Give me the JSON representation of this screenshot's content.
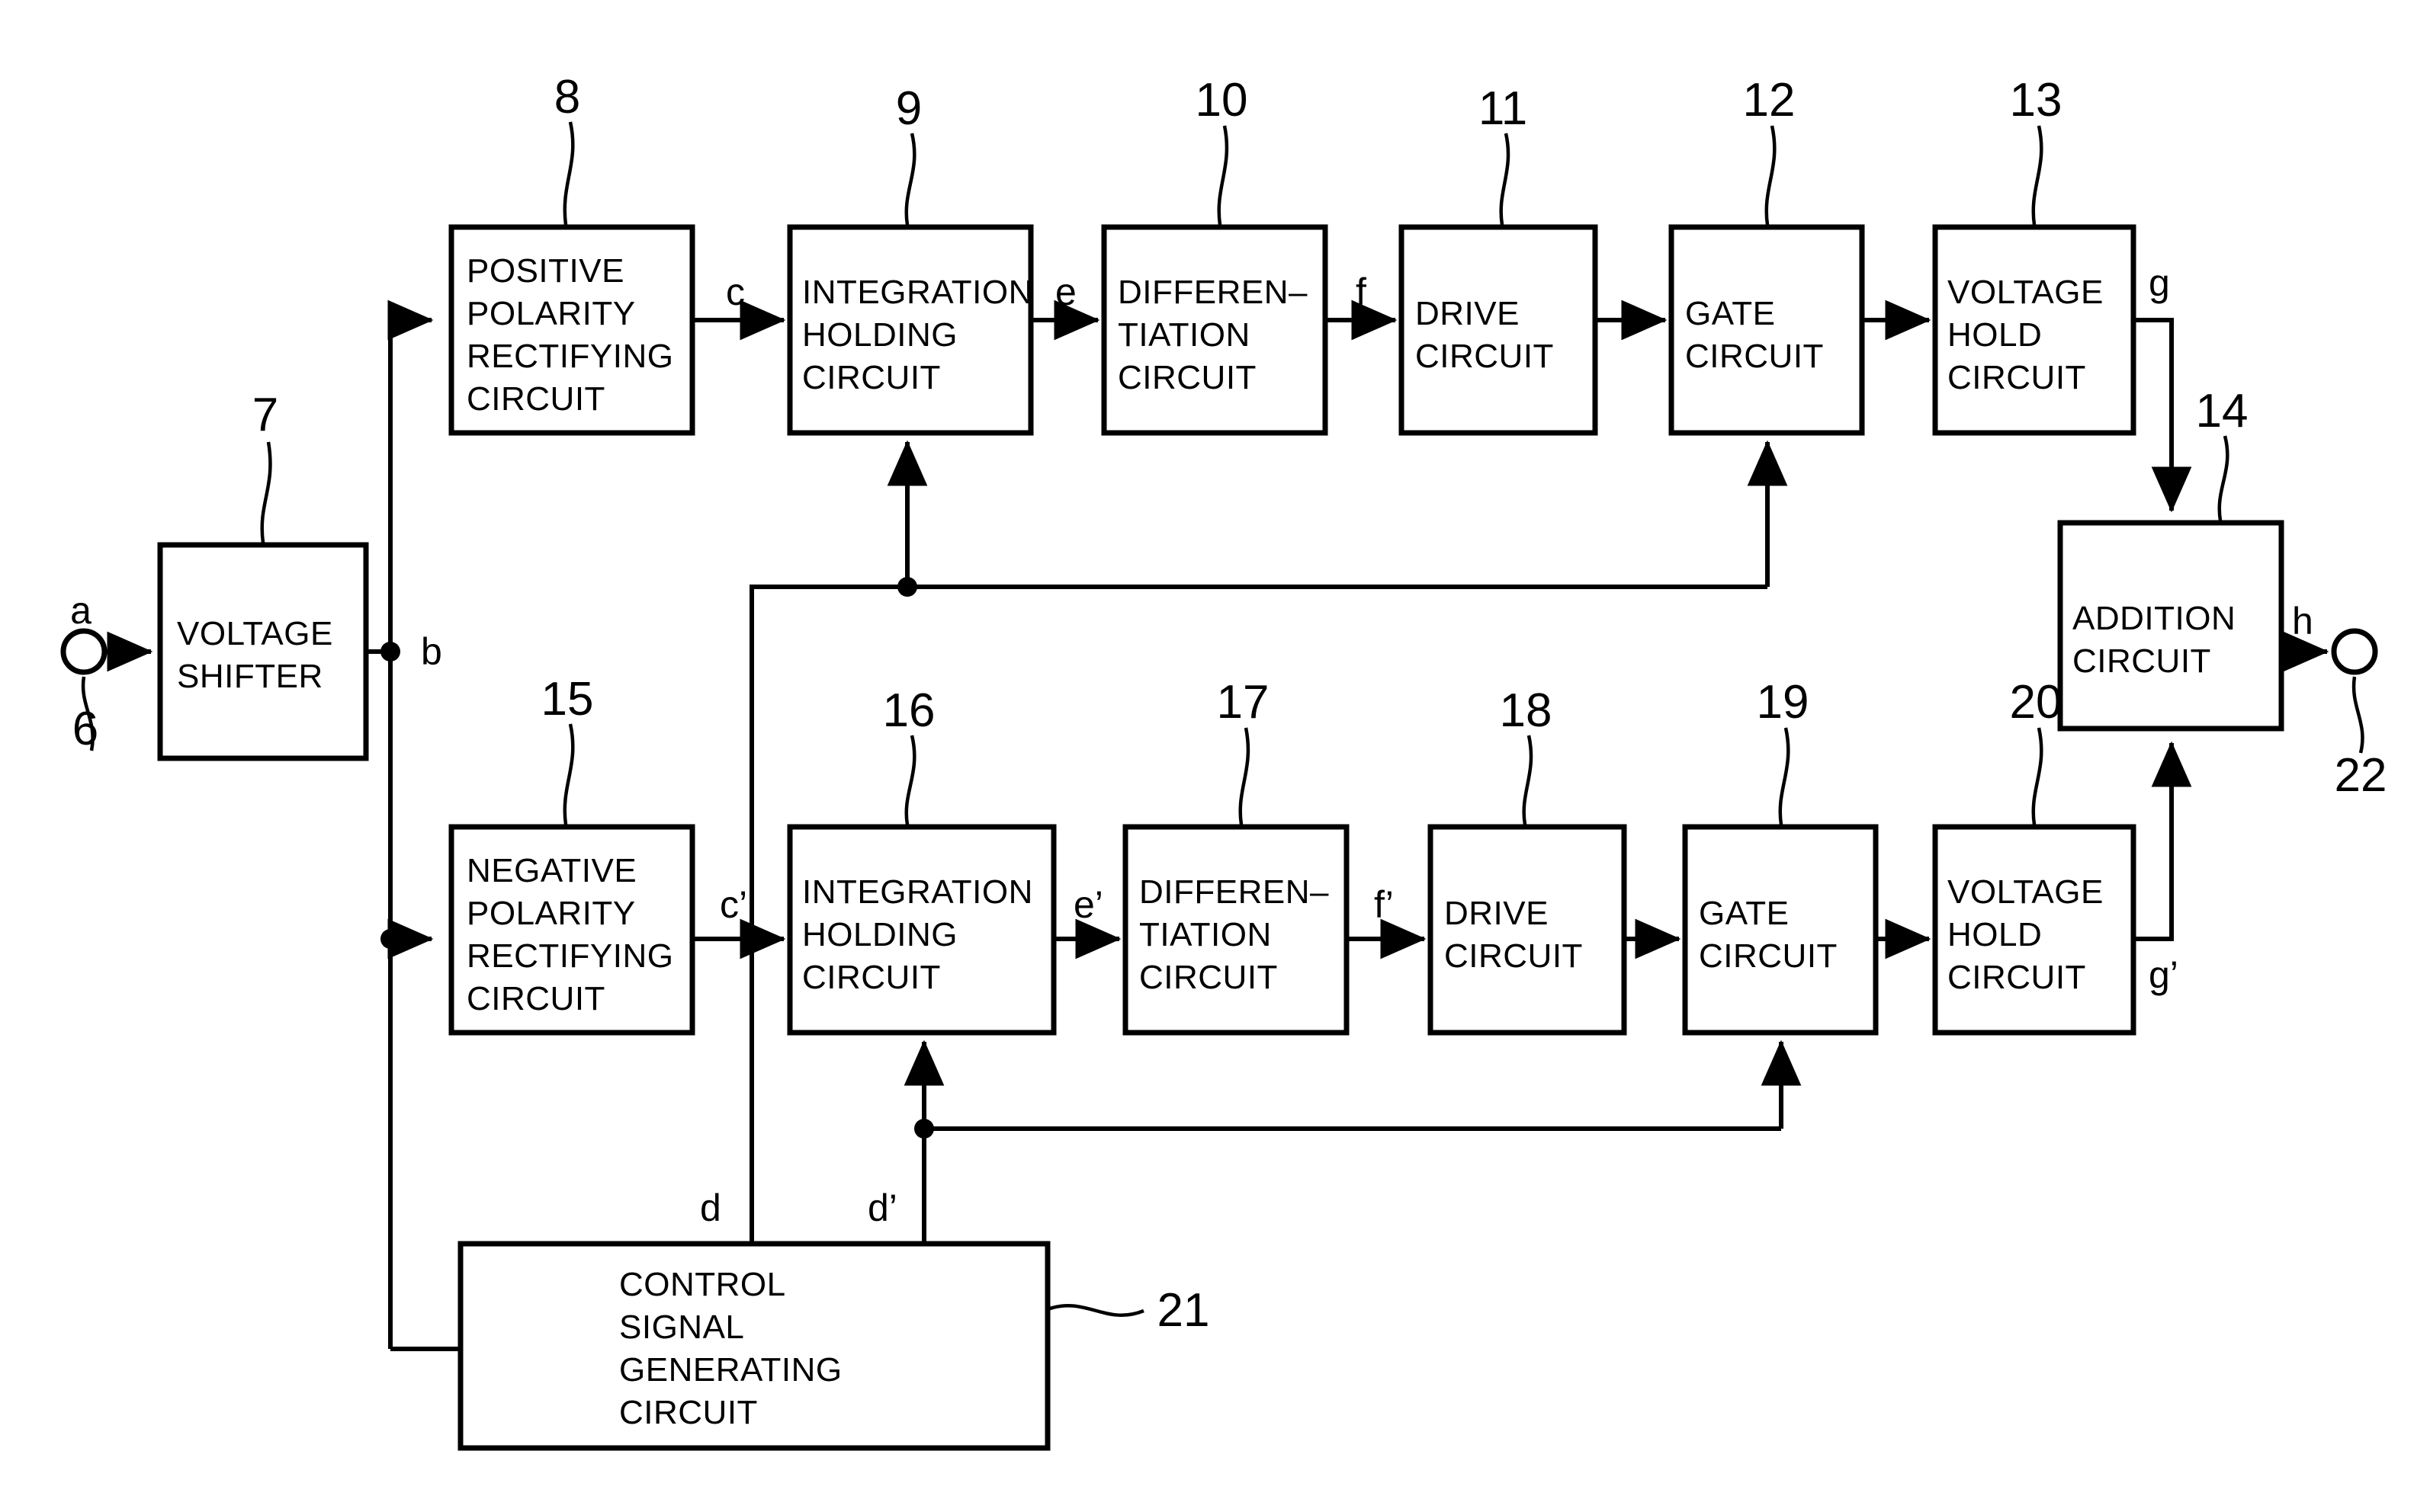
{
  "figure": {
    "kind": "patent-block-diagram",
    "background_color": "#ffffff",
    "line_color": "#000000"
  },
  "blocks": [
    {
      "id": "voltage-shifter",
      "ref": "7",
      "lines": [
        "VOLTAGE",
        "SHIFTER"
      ]
    },
    {
      "id": "positive-polarity-rectifier",
      "ref": "8",
      "lines": [
        "POSITIVE",
        "POLARITY",
        "RECTIFYING",
        "CIRCUIT"
      ]
    },
    {
      "id": "integration-holding-top",
      "ref": "9",
      "lines": [
        "INTEGRATION",
        "HOLDING",
        "CIRCUIT"
      ]
    },
    {
      "id": "differentiation-top",
      "ref": "10",
      "lines": [
        "DIFFEREN–",
        "TIATION",
        "CIRCUIT"
      ]
    },
    {
      "id": "drive-top",
      "ref": "11",
      "lines": [
        "DRIVE",
        "CIRCUIT"
      ]
    },
    {
      "id": "gate-top",
      "ref": "12",
      "lines": [
        "GATE",
        "CIRCUIT"
      ]
    },
    {
      "id": "voltage-hold-top",
      "ref": "13",
      "lines": [
        "VOLTAGE",
        "HOLD",
        "CIRCUIT"
      ]
    },
    {
      "id": "addition",
      "ref": "14",
      "lines": [
        "ADDITION",
        "CIRCUIT"
      ]
    },
    {
      "id": "negative-polarity-rectifier",
      "ref": "15",
      "lines": [
        "NEGATIVE",
        "POLARITY",
        "RECTIFYING",
        "CIRCUIT"
      ]
    },
    {
      "id": "integration-holding-bottom",
      "ref": "16",
      "lines": [
        "INTEGRATION",
        "HOLDING",
        "CIRCUIT"
      ]
    },
    {
      "id": "differentiation-bottom",
      "ref": "17",
      "lines": [
        "DIFFEREN–",
        "TIATION",
        "CIRCUIT"
      ]
    },
    {
      "id": "drive-bottom",
      "ref": "18",
      "lines": [
        "DRIVE",
        "CIRCUIT"
      ]
    },
    {
      "id": "gate-bottom",
      "ref": "19",
      "lines": [
        "GATE",
        "CIRCUIT"
      ]
    },
    {
      "id": "voltage-hold-bottom",
      "ref": "20",
      "lines": [
        "VOLTAGE",
        "HOLD",
        "CIRCUIT"
      ]
    },
    {
      "id": "control-signal-generator",
      "ref": "21",
      "lines": [
        "CONTROL",
        "SIGNAL",
        "GENERATING",
        "CIRCUIT"
      ]
    }
  ],
  "block_text": {
    "voltage_shifter_l1": "VOLTAGE",
    "voltage_shifter_l2": "SHIFTER",
    "pos_rect_l1": "POSITIVE",
    "pos_rect_l2": "POLARITY",
    "pos_rect_l3": "RECTIFYING",
    "pos_rect_l4": "CIRCUIT",
    "integ_top_l1": "INTEGRATION",
    "integ_top_l2": "HOLDING",
    "integ_top_l3": "CIRCUIT",
    "diff_top_l1": "DIFFEREN–",
    "diff_top_l2": "TIATION",
    "diff_top_l3": "CIRCUIT",
    "drive_top_l1": "DRIVE",
    "drive_top_l2": "CIRCUIT",
    "gate_top_l1": "GATE",
    "gate_top_l2": "CIRCUIT",
    "vhold_top_l1": "VOLTAGE",
    "vhold_top_l2": "HOLD",
    "vhold_top_l3": "CIRCUIT",
    "addition_l1": "ADDITION",
    "addition_l2": "CIRCUIT",
    "neg_rect_l1": "NEGATIVE",
    "neg_rect_l2": "POLARITY",
    "neg_rect_l3": "RECTIFYING",
    "neg_rect_l4": "CIRCUIT",
    "integ_bot_l1": "INTEGRATION",
    "integ_bot_l2": "HOLDING",
    "integ_bot_l3": "CIRCUIT",
    "diff_bot_l1": "DIFFEREN–",
    "diff_bot_l2": "TIATION",
    "diff_bot_l3": "CIRCUIT",
    "drive_bot_l1": "DRIVE",
    "drive_bot_l2": "CIRCUIT",
    "gate_bot_l1": "GATE",
    "gate_bot_l2": "CIRCUIT",
    "vhold_bot_l1": "VOLTAGE",
    "vhold_bot_l2": "HOLD",
    "vhold_bot_l3": "CIRCUIT",
    "ctrl_l1": "CONTROL",
    "ctrl_l2": "SIGNAL",
    "ctrl_l3": "GENERATING",
    "ctrl_l4": "CIRCUIT"
  },
  "reference_numerals": {
    "n6": "6",
    "n7": "7",
    "n8": "8",
    "n9": "9",
    "n10": "10",
    "n11": "11",
    "n12": "12",
    "n13": "13",
    "n14": "14",
    "n15": "15",
    "n16": "16",
    "n17": "17",
    "n18": "18",
    "n19": "19",
    "n20": "20",
    "n21": "21",
    "n22": "22"
  },
  "signal_labels": {
    "a": "a",
    "b": "b",
    "c": "c",
    "c_prime": "c’",
    "d": "d",
    "d_prime": "d’",
    "e": "e",
    "e_prime": "e’",
    "f": "f",
    "f_prime": "f’",
    "g": "g",
    "g_prime": "g’",
    "h": "h"
  },
  "terminals": [
    {
      "id": "input-terminal",
      "signal": "a",
      "ref": "6"
    },
    {
      "id": "output-terminal",
      "signal": "h",
      "ref": "22"
    }
  ]
}
